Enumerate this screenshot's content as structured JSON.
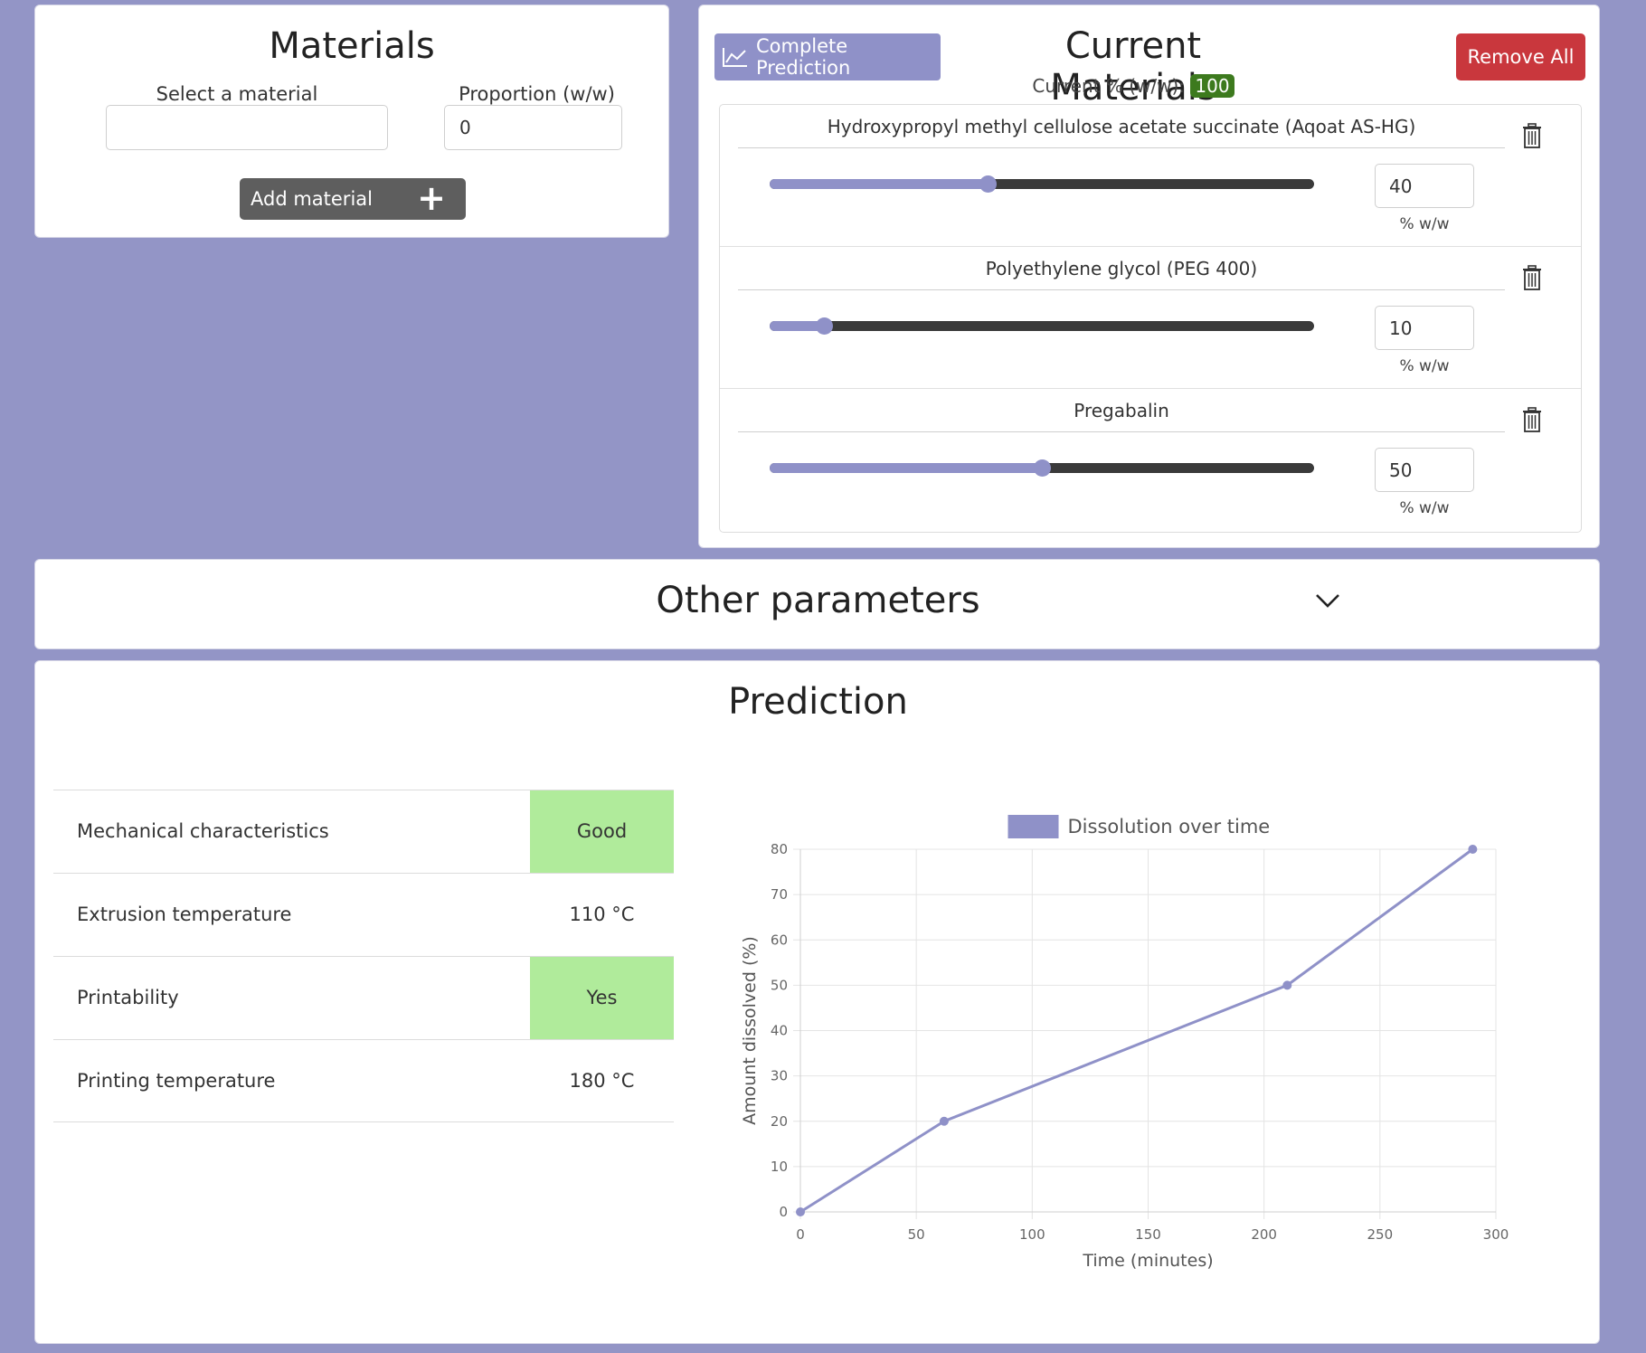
{
  "materials": {
    "title": "Materials",
    "select_label": "Select a material",
    "select_value": "",
    "proportion_label": "Proportion (w/w)",
    "proportion_value": "0",
    "add_button": "Add material",
    "add_icon": "plus-icon"
  },
  "current": {
    "title": "Current Materials",
    "complete_button": "Complete Prediction",
    "complete_icon": "line-chart-icon",
    "remove_all_button": "Remove All",
    "pct_label": "Current % (w/w):",
    "pct_total": "100",
    "unit": "% w/w",
    "items": [
      {
        "name": "Hydroxypropyl methyl cellulose acetate succinate (Aqoat AS-HG)",
        "value": "40",
        "fraction": 0.4
      },
      {
        "name": "Polyethylene glycol (PEG 400)",
        "value": "10",
        "fraction": 0.1
      },
      {
        "name": "Pregabalin",
        "value": "50",
        "fraction": 0.5
      }
    ]
  },
  "other": {
    "title": "Other parameters",
    "icon": "chevron-down-icon"
  },
  "prediction": {
    "title": "Prediction",
    "rows": [
      {
        "label": "Mechanical characteristics",
        "value": "Good",
        "highlight": true
      },
      {
        "label": "Extrusion temperature",
        "value": "110 °C",
        "highlight": false
      },
      {
        "label": "Printability",
        "value": "Yes",
        "highlight": true
      },
      {
        "label": "Printing temperature",
        "value": "180 °C",
        "highlight": false
      }
    ]
  },
  "colors": {
    "accent": "#8f91c8",
    "background": "#9395c6",
    "danger": "#c9373d",
    "success_badge": "#3d7a1e",
    "highlight": "#b0eb9b"
  },
  "chart_data": {
    "type": "line",
    "series": [
      {
        "name": "Dissolution over time",
        "x": [
          0,
          62,
          210,
          290
        ],
        "y": [
          0,
          20,
          50,
          80
        ]
      }
    ],
    "xlabel": "Time (minutes)",
    "ylabel": "Amount dissolved (%)",
    "xlim": [
      0,
      300
    ],
    "ylim": [
      0,
      80
    ],
    "xticks": [
      0,
      50,
      100,
      150,
      200,
      250,
      300
    ],
    "yticks": [
      0,
      10,
      20,
      30,
      40,
      50,
      60,
      70,
      80
    ],
    "grid": true,
    "legend": "top"
  }
}
